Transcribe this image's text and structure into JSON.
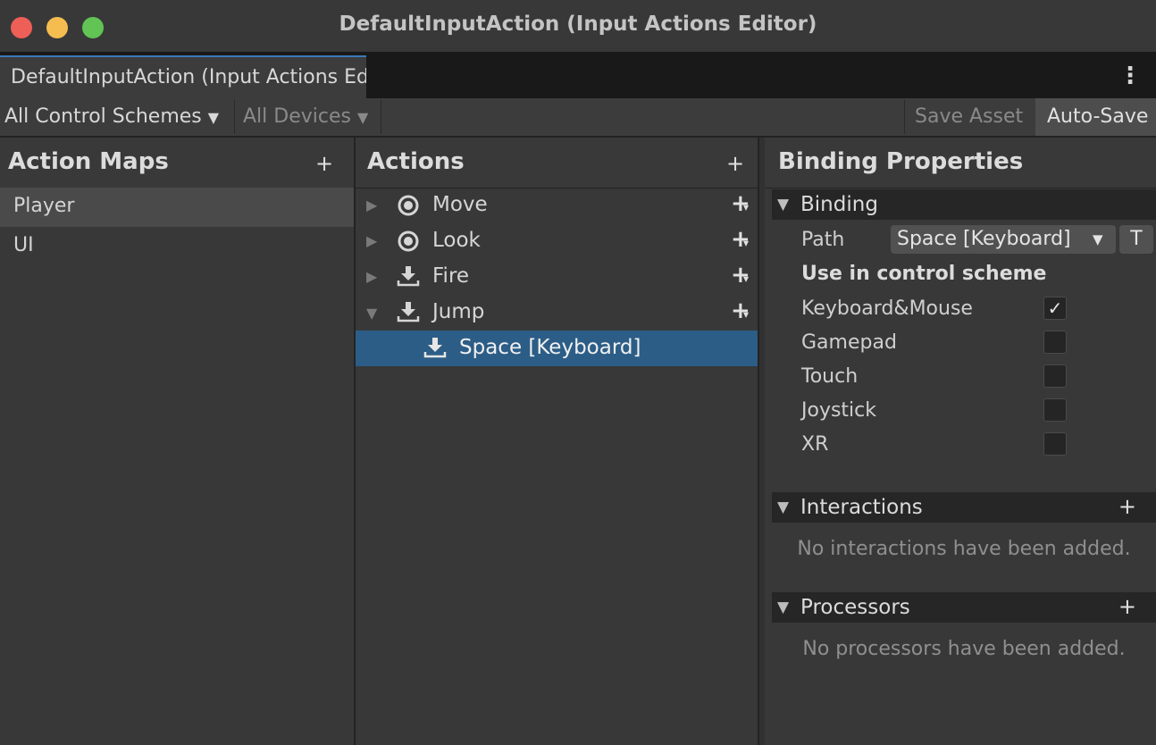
{
  "window": {
    "title": "DefaultInputAction (Input Actions Editor)",
    "tab_label": "DefaultInputAction (Input Actions Editor)",
    "menu_icon": "kebab-menu-icon"
  },
  "toolbar": {
    "control_schemes": "All Control Schemes",
    "devices": "All Devices",
    "save_asset": "Save Asset",
    "auto_save": "Auto-Save"
  },
  "action_maps": {
    "title": "Action Maps",
    "add": "+",
    "items": [
      "Player",
      "UI"
    ],
    "selected": "Player"
  },
  "actions": {
    "title": "Actions",
    "add": "+",
    "items": [
      {
        "label": "Move",
        "icon": "stick-icon",
        "expanded": false
      },
      {
        "label": "Look",
        "icon": "stick-icon",
        "expanded": false
      },
      {
        "label": "Fire",
        "icon": "button-icon",
        "expanded": false
      },
      {
        "label": "Jump",
        "icon": "button-icon",
        "expanded": true
      }
    ],
    "binding": {
      "label": "Space [Keyboard]",
      "icon": "button-icon",
      "selected": true
    }
  },
  "binding_properties": {
    "title": "Binding Properties",
    "binding_section": "Binding",
    "path_label": "Path",
    "path_value": "Space [Keyboard]",
    "path_mode": "T",
    "scheme_heading": "Use in control scheme",
    "schemes": [
      {
        "label": "Keyboard&Mouse",
        "checked": true
      },
      {
        "label": "Gamepad",
        "checked": false
      },
      {
        "label": "Touch",
        "checked": false
      },
      {
        "label": "Joystick",
        "checked": false
      },
      {
        "label": "XR",
        "checked": false
      }
    ],
    "interactions_section": "Interactions",
    "interactions_empty": "No interactions have been added.",
    "processors_section": "Processors",
    "processors_empty": "No processors have been added.",
    "add": "+"
  },
  "colors": {
    "accent": "#3a79bb",
    "selection": "#2c5d87",
    "close": "#ee5f57",
    "minimize": "#f5bd4f",
    "maximize": "#61c454"
  }
}
